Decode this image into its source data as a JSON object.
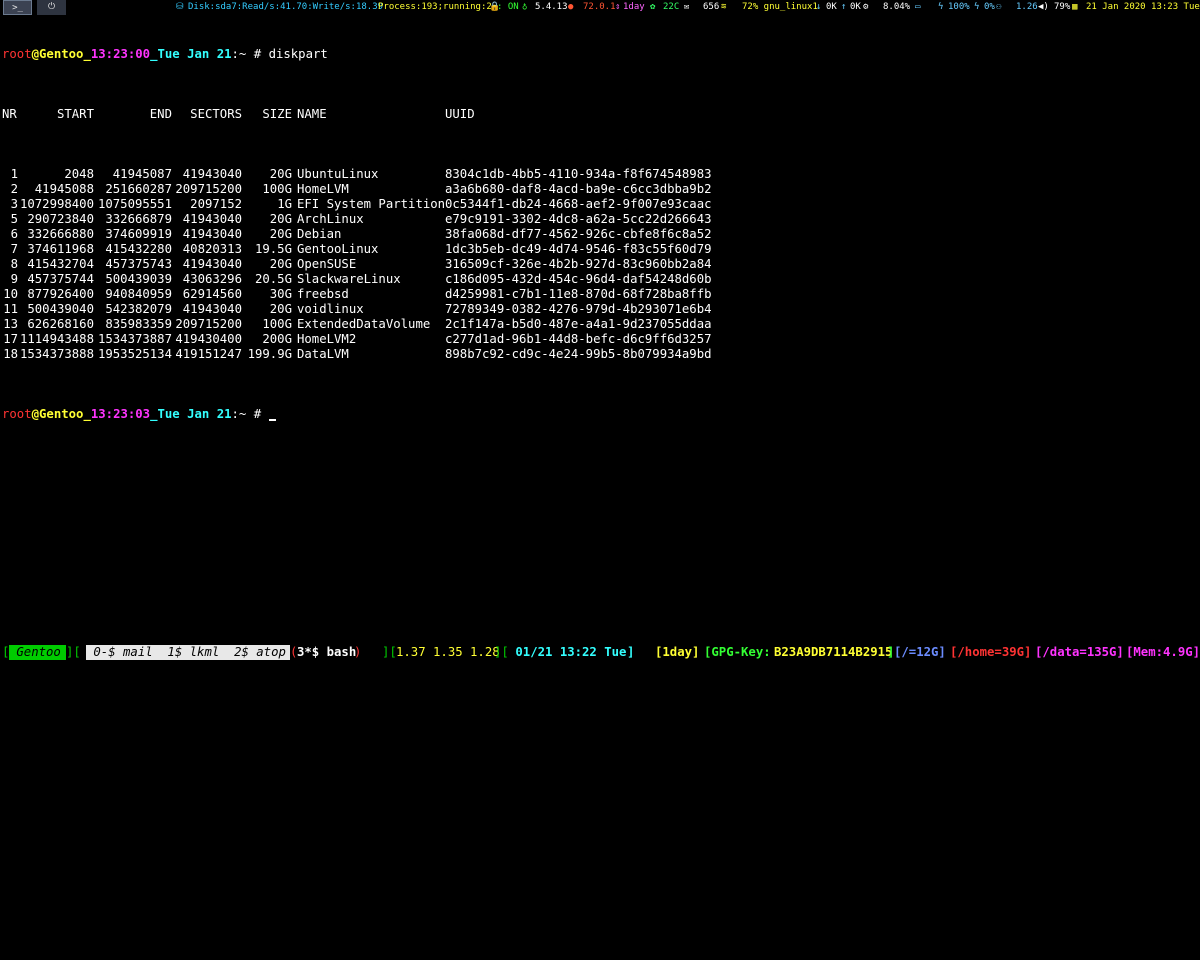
{
  "topbar": {
    "terminal_icon": ">_",
    "power_icon": "⏻",
    "disk": "Disk:sda7:Read/s:41.70:Write/s:18.39",
    "process": "Process:193;running:2",
    "lock_status": ": ON",
    "kernel": "5.4.13",
    "firefox": "72.0.1",
    "uptime": "1day",
    "temp": "22C",
    "mail_count": "656",
    "wifi": "72% gnu_linux1",
    "down": "0K",
    "up": "0K",
    "cpu": "8.04%",
    "battery1": "100%",
    "battery2": "0%",
    "load": "1.26",
    "volume": "79%",
    "clock": "21 Jan 2020 13:23 Tue",
    "colors": {
      "disk": "#33ccff",
      "process": "#ffff33",
      "green": "#33ff33",
      "kernel": "#ffffff",
      "firefox": "#ff5533",
      "uptime": "#ff66ff",
      "temp": "#33ff66",
      "wifi": "#ffff33",
      "blue": "#66ccff",
      "clock": "#ffff33"
    }
  },
  "prompt1": {
    "user": "root",
    "host": "@Gentoo_",
    "time": "13:23:00",
    "date": "_Tue Jan 21",
    "rest": ":~ # ",
    "command": "diskpart"
  },
  "table": {
    "headers": [
      "NR",
      "START",
      "END",
      "SECTORS",
      "SIZE",
      "NAME",
      "UUID"
    ],
    "rows": [
      [
        "1",
        "2048",
        "41945087",
        "41943040",
        "20G",
        "UbuntuLinux",
        "8304c1db-4bb5-4110-934a-f8f674548983"
      ],
      [
        "2",
        "41945088",
        "251660287",
        "209715200",
        "100G",
        "HomeLVM",
        "a3a6b680-daf8-4acd-ba9e-c6cc3dbba9b2"
      ],
      [
        "3",
        "1072998400",
        "1075095551",
        "2097152",
        "1G",
        "EFI System Partition",
        "0c5344f1-db24-4668-aef2-9f007e93caac"
      ],
      [
        "5",
        "290723840",
        "332666879",
        "41943040",
        "20G",
        "ArchLinux",
        "e79c9191-3302-4dc8-a62a-5cc22d266643"
      ],
      [
        "6",
        "332666880",
        "374609919",
        "41943040",
        "20G",
        "Debian",
        "38fa068d-df77-4562-926c-cbfe8f6c8a52"
      ],
      [
        "7",
        "374611968",
        "415432280",
        "40820313",
        "19.5G",
        "GentooLinux",
        "1dc3b5eb-dc49-4d74-9546-f83c55f60d79"
      ],
      [
        "8",
        "415432704",
        "457375743",
        "41943040",
        "20G",
        "OpenSUSE",
        "316509cf-326e-4b2b-927d-83c960bb2a84"
      ],
      [
        "9",
        "457375744",
        "500439039",
        "43063296",
        "20.5G",
        "SlackwareLinux",
        "c186d095-432d-454c-96d4-daf54248d60b"
      ],
      [
        "10",
        "877926400",
        "940840959",
        "62914560",
        "30G",
        "freebsd",
        "d4259981-c7b1-11e8-870d-68f728ba8ffb"
      ],
      [
        "11",
        "500439040",
        "542382079",
        "41943040",
        "20G",
        "voidlinux",
        "72789349-0382-4276-979d-4b293071e6b4"
      ],
      [
        "13",
        "626268160",
        "835983359",
        "209715200",
        "100G",
        "ExtendedDataVolume",
        "2c1f147a-b5d0-487e-a4a1-9d237055ddaa"
      ],
      [
        "17",
        "1114943488",
        "1534373887",
        "419430400",
        "200G",
        "HomeLVM2",
        "c277d1ad-96b1-44d8-befc-d6c9ff6d3257"
      ],
      [
        "18",
        "1534373888",
        "1953525134",
        "419151247",
        "199.9G",
        "DataLVM",
        "898b7c92-cd9c-4e24-99b5-8b079934a9bd"
      ]
    ]
  },
  "prompt2": {
    "user": "root",
    "host": "@Gentoo_",
    "time": "13:23:03",
    "date": "_Tue Jan 21",
    "rest": ":~ # "
  },
  "statusbar": {
    "open1": "[",
    "session": " Gentoo ",
    "close1": "][",
    "windows": " 0-$ mail  1$ lkml  2$ atop ",
    "open2": "(",
    "active_window": "3*$ bash",
    "close2": ")",
    "load_open": "][",
    "load": "1.37 1.35 1.28",
    "load_close": "][",
    "datetime": " 01/21 13:22 Tue ",
    "dt_close": "]",
    "uptime": "[1day]",
    "gpg_label": "[GPG-Key: ",
    "gpg_key": "B23A9DB7114B2915",
    "gpg_close": "]",
    "root_fs": "[/=12G]",
    "home_fs": "[/home=39G]",
    "data_fs": "[/data=135G]",
    "mem": "[Mem:4.9G]",
    "colors": {
      "bracket_green": "#00cc00",
      "load": "#ffff33",
      "datetime": "#33ffff",
      "uptime": "#ffff33",
      "gpg": "#33ff33",
      "root_fs": "#6b8cff",
      "home_fs": "#ff3333",
      "data_fs": "#ff33ff",
      "mem": "#ff33ff"
    }
  }
}
